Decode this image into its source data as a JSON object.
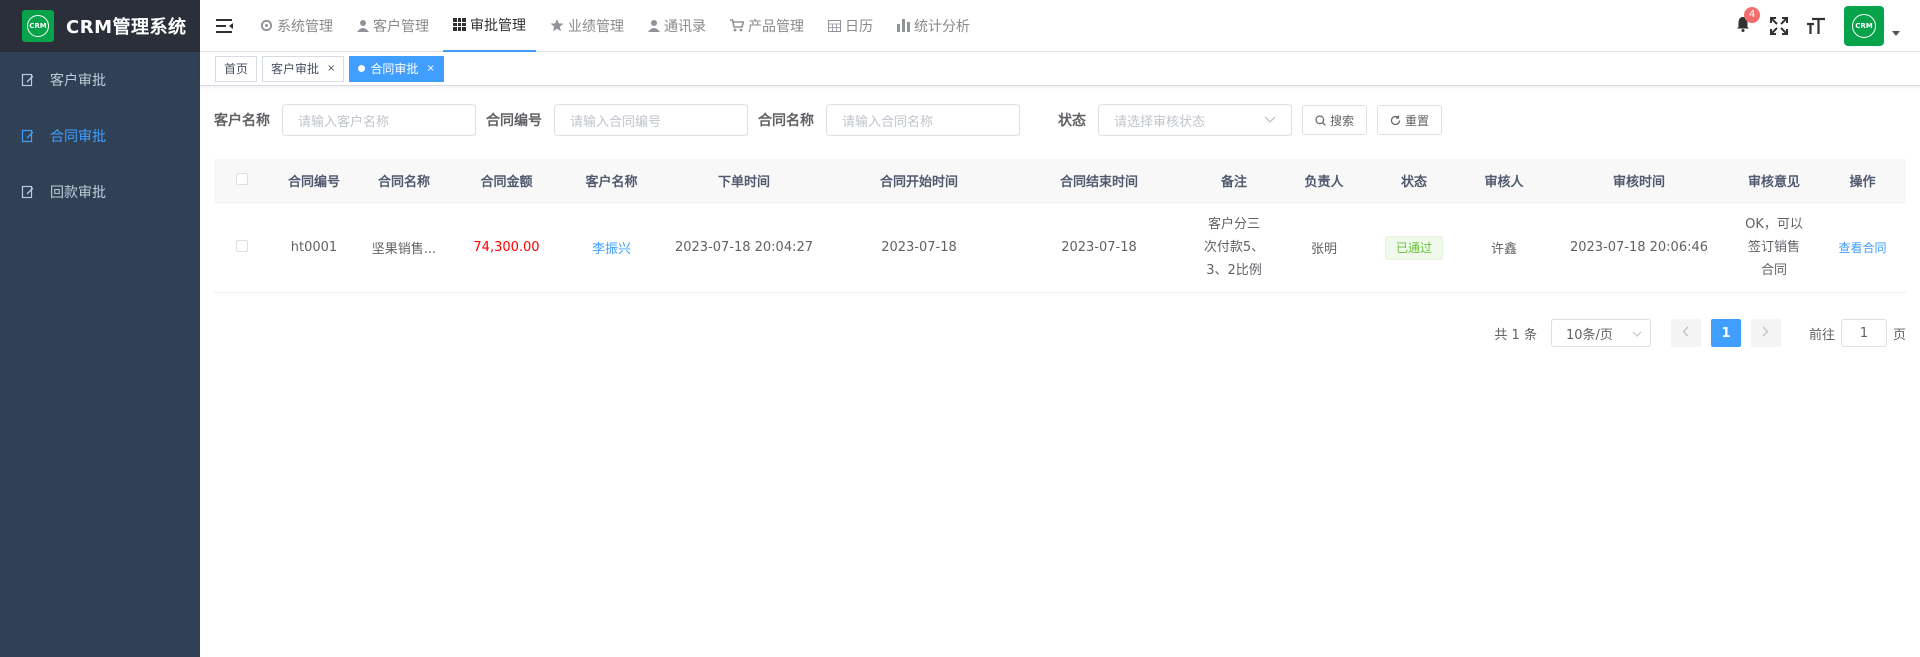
{
  "app": {
    "title": "CRM管理系统",
    "logo_text": "CRM"
  },
  "sidebar": {
    "items": [
      {
        "label": "客户审批",
        "icon": "edit-doc-icon",
        "active": false
      },
      {
        "label": "合同审批",
        "icon": "edit-doc-icon",
        "active": true
      },
      {
        "label": "回款审批",
        "icon": "edit-doc-icon",
        "active": false
      }
    ]
  },
  "topnav": {
    "items": [
      {
        "label": "系统管理",
        "icon": "gear-icon"
      },
      {
        "label": "客户管理",
        "icon": "user-icon"
      },
      {
        "label": "审批管理",
        "icon": "grid-icon",
        "active": true
      },
      {
        "label": "业绩管理",
        "icon": "star-icon"
      },
      {
        "label": "通讯录",
        "icon": "user-icon"
      },
      {
        "label": "产品管理",
        "icon": "cart-icon"
      },
      {
        "label": "日历",
        "icon": "calendar-icon"
      },
      {
        "label": "统计分析",
        "icon": "bar-chart-icon"
      }
    ],
    "notification_count": "4"
  },
  "tags": {
    "items": [
      {
        "label": "首页",
        "closable": false,
        "active": false
      },
      {
        "label": "客户审批",
        "closable": true,
        "active": false
      },
      {
        "label": "合同审批",
        "closable": true,
        "active": true
      }
    ],
    "close_glyph": "×"
  },
  "search": {
    "customer_name_label": "客户名称",
    "customer_name_placeholder": "请输入客户名称",
    "contract_no_label": "合同编号",
    "contract_no_placeholder": "请输入合同编号",
    "contract_name_label": "合同名称",
    "contract_name_placeholder": "请输入合同名称",
    "status_label": "状态",
    "status_placeholder": "请选择审核状态",
    "search_button": "搜索",
    "reset_button": "重置"
  },
  "table": {
    "columns": [
      "合同编号",
      "合同名称",
      "合同金额",
      "客户名称",
      "下单时间",
      "合同开始时间",
      "合同结束时间",
      "备注",
      "负责人",
      "状态",
      "审核人",
      "审核时间",
      "审核意见",
      "操作"
    ],
    "rows": [
      {
        "contract_no": "ht0001",
        "contract_name": "坚果销售...",
        "amount": "74,300.00",
        "customer": "李振兴",
        "order_time": "2023-07-18 20:04:27",
        "start_date": "2023-07-18",
        "end_date": "2023-07-18",
        "note_lines": [
          "客户分三",
          "次付款5、",
          "3、2比例"
        ],
        "owner": "张明",
        "status": "已通过",
        "reviewer": "许鑫",
        "review_time": "2023-07-18 20:06:46",
        "opinion_lines": [
          "OK，可以",
          "签订销售",
          "合同"
        ],
        "action": "查看合同"
      }
    ]
  },
  "pagination": {
    "total": "共 1 条",
    "page_size": "10条/页",
    "current_page": "1",
    "goto_prefix": "前往",
    "goto_value": "1",
    "goto_suffix": "页"
  },
  "colors": {
    "sidebar_bg": "#304156",
    "accent": "#409eff",
    "brand_green": "#07a34a",
    "amount_red": "#ff0000"
  }
}
